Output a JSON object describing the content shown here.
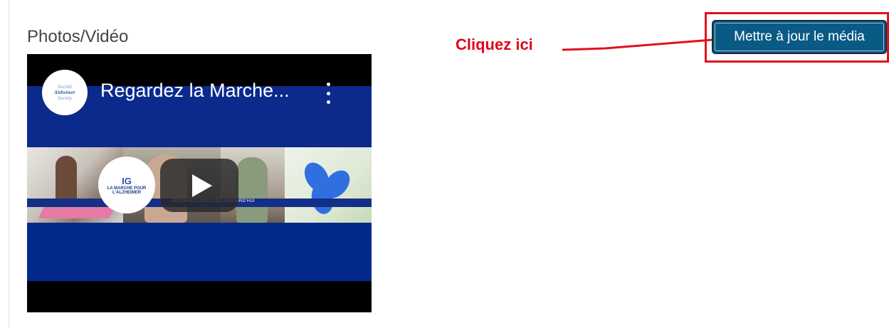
{
  "section": {
    "label": "Photos/Vidéo"
  },
  "video": {
    "title": "Regardez la Marche...",
    "channel_avatar_lines": [
      "Société",
      "Alzheimer",
      "Society"
    ],
    "logo_badge": "IG",
    "logo_lines": [
      "LA MARCHE POUR",
      "L'ALZHEIMER"
    ],
    "strip_caption": "INSCRIVEZ-VOUS DÈS AUJOURD'HUI",
    "colors": {
      "banner_blue": "#0b2a8c",
      "letterbox": "#000000",
      "play_button": "#282828"
    },
    "icons": [
      "kebab-menu-icon",
      "play-icon"
    ]
  },
  "annotation": {
    "label": "Cliquez ici",
    "color": "#e0061a"
  },
  "update_button": {
    "label": "Mettre à jour le média",
    "color": "#0a5a86"
  }
}
